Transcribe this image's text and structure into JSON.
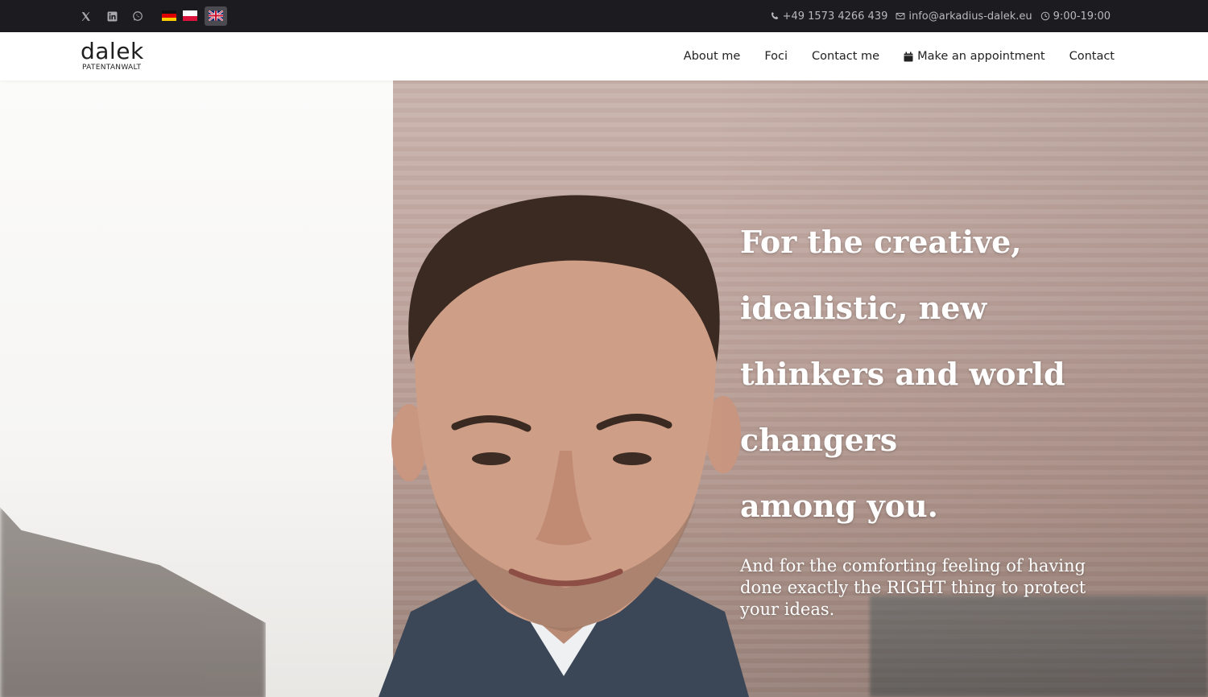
{
  "topbar": {
    "social": [
      {
        "icon": "x-twitter-icon"
      },
      {
        "icon": "linkedin-icon"
      },
      {
        "icon": "whatsapp-icon"
      }
    ],
    "languages": [
      {
        "code": "de",
        "icon": "flag-germany-icon"
      },
      {
        "code": "pl",
        "icon": "flag-poland-icon"
      },
      {
        "code": "en",
        "icon": "flag-uk-icon",
        "active": true
      }
    ],
    "phone": "+49 1573 4266 439",
    "email": "info@arkadius-dalek.eu",
    "hours": "9:00-19:00",
    "background_color": "#1c1b20"
  },
  "header": {
    "logo_word": "dalek",
    "logo_sub": "PATENTANWALT",
    "nav": [
      {
        "label": "About me"
      },
      {
        "label": "Foci"
      },
      {
        "label": "Contact me"
      },
      {
        "label": "Make an appointment",
        "icon": "calendar-icon"
      },
      {
        "label": "Contact"
      }
    ]
  },
  "hero": {
    "heading_lines": [
      "For the creative,",
      "idealistic, new",
      "thinkers and world",
      "changers",
      "among you."
    ],
    "subtext": "And for the comforting feeling of having done exactly the RIGHT thing to protect your ideas.",
    "text_color": "#ffffff"
  }
}
